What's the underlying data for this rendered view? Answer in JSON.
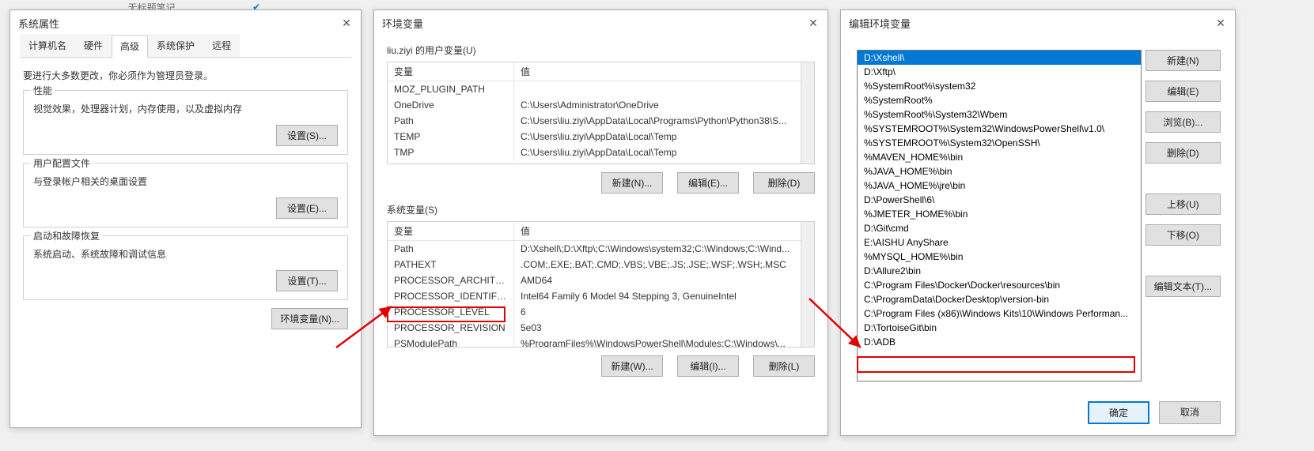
{
  "dialog1": {
    "title": "系统属性",
    "tabs": [
      "计算机名",
      "硬件",
      "高级",
      "系统保护",
      "远程"
    ],
    "active_tab": 2,
    "note": "要进行大多数更改，你必须作为管理员登录。",
    "perf": {
      "title": "性能",
      "desc": "视觉效果，处理器计划，内存使用，以及虚拟内存",
      "btn": "设置(S)..."
    },
    "userprof": {
      "title": "用户配置文件",
      "desc": "与登录帐户相关的桌面设置",
      "btn": "设置(E)..."
    },
    "startup": {
      "title": "启动和故障恢复",
      "desc": "系统启动、系统故障和调试信息",
      "btn": "设置(T)..."
    },
    "envbtn": "环境变量(N)...",
    "top_item": "无标题笔记"
  },
  "dialog2": {
    "title": "环境变量",
    "user_label": "liu.ziyi 的用户变量(U)",
    "sys_label": "系统变量(S)",
    "th_var": "变量",
    "th_val": "值",
    "user_rows": [
      {
        "k": "MOZ_PLUGIN_PATH",
        "v": ""
      },
      {
        "k": "OneDrive",
        "v": "C:\\Users\\Administrator\\OneDrive"
      },
      {
        "k": "Path",
        "v": "C:\\Users\\liu.ziyi\\AppData\\Local\\Programs\\Python\\Python38\\S..."
      },
      {
        "k": "TEMP",
        "v": "C:\\Users\\liu.ziyi\\AppData\\Local\\Temp"
      },
      {
        "k": "TMP",
        "v": "C:\\Users\\liu.ziyi\\AppData\\Local\\Temp"
      }
    ],
    "sys_rows": [
      {
        "k": "Path",
        "v": "D:\\Xshell\\;D:\\Xftp\\;C:\\Windows\\system32;C:\\Windows;C:\\Wind..."
      },
      {
        "k": "PATHEXT",
        "v": ".COM;.EXE;.BAT;.CMD;.VBS;.VBE;.JS;.JSE;.WSF;.WSH;.MSC"
      },
      {
        "k": "PROCESSOR_ARCHITECT...",
        "v": "AMD64"
      },
      {
        "k": "PROCESSOR_IDENTIFIER",
        "v": "Intel64 Family 6 Model 94 Stepping 3, GenuineIntel"
      },
      {
        "k": "PROCESSOR_LEVEL",
        "v": "6"
      },
      {
        "k": "PROCESSOR_REVISION",
        "v": "5e03"
      },
      {
        "k": "PSModulePath",
        "v": "%ProgramFiles%\\WindowsPowerShell\\Modules;C:\\Windows\\..."
      }
    ],
    "btn_new": "新建(N)...",
    "btn_edit": "编辑(E)...",
    "btn_del": "删除(D)",
    "btn_new2": "新建(W)...",
    "btn_edit2": "编辑(I)...",
    "btn_del2": "删除(L)"
  },
  "dialog3": {
    "title": "编辑环境变量",
    "items": [
      "D:\\Xshell\\",
      "D:\\Xftp\\",
      "%SystemRoot%\\system32",
      "%SystemRoot%",
      "%SystemRoot%\\System32\\Wbem",
      "%SYSTEMROOT%\\System32\\WindowsPowerShell\\v1.0\\",
      "%SYSTEMROOT%\\System32\\OpenSSH\\",
      "%MAVEN_HOME%\\bin",
      "%JAVA_HOME%\\bin",
      "%JAVA_HOME%\\jre\\bin",
      "D:\\PowerShell\\6\\",
      "%JMETER_HOME%\\bin",
      "D:\\Git\\cmd",
      "E:\\AISHU AnyShare",
      "%MYSQL_HOME%\\bin",
      "D:\\Allure2\\bin",
      "C:\\Program Files\\Docker\\Docker\\resources\\bin",
      "C:\\ProgramData\\DockerDesktop\\version-bin",
      "C:\\Program Files (x86)\\Windows Kits\\10\\Windows Performan...",
      "D:\\TortoiseGit\\bin",
      "D:\\ADB"
    ],
    "selected_index": 0,
    "btn_new": "新建(N)",
    "btn_edit": "编辑(E)",
    "btn_browse": "浏览(B)...",
    "btn_del": "删除(D)",
    "btn_up": "上移(U)",
    "btn_down": "下移(O)",
    "btn_edittext": "编辑文本(T)...",
    "btn_ok": "确定",
    "btn_cancel": "取消"
  }
}
